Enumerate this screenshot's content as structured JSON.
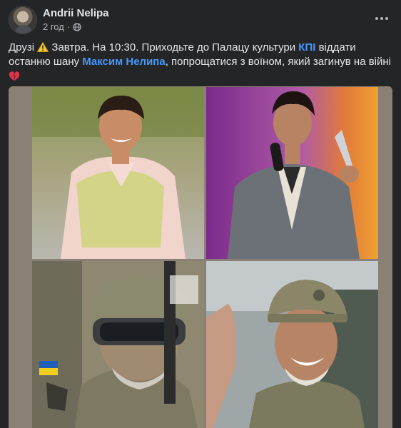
{
  "post": {
    "author": "Andrii Nelipa",
    "time": "2 год",
    "separator": "·",
    "text_part1": "Друзі",
    "text_part2": "Завтра. На 10:30. Приходьте до Палацу культури",
    "link_kpi": "КПІ",
    "text_part3": "віддати останню шану",
    "link_person": "Максим Нелипа",
    "text_part4": ", попрощатися з воїном, який загинув на війні",
    "icons": {
      "warning": "warning-icon",
      "heart": "broken-heart-icon",
      "audience": "globe-icon",
      "menu": "more-options-icon"
    }
  },
  "media": {
    "photo_count": 4,
    "colors": {
      "link": "#4599ff",
      "background": "#242526",
      "frame": "#8a8075"
    }
  }
}
